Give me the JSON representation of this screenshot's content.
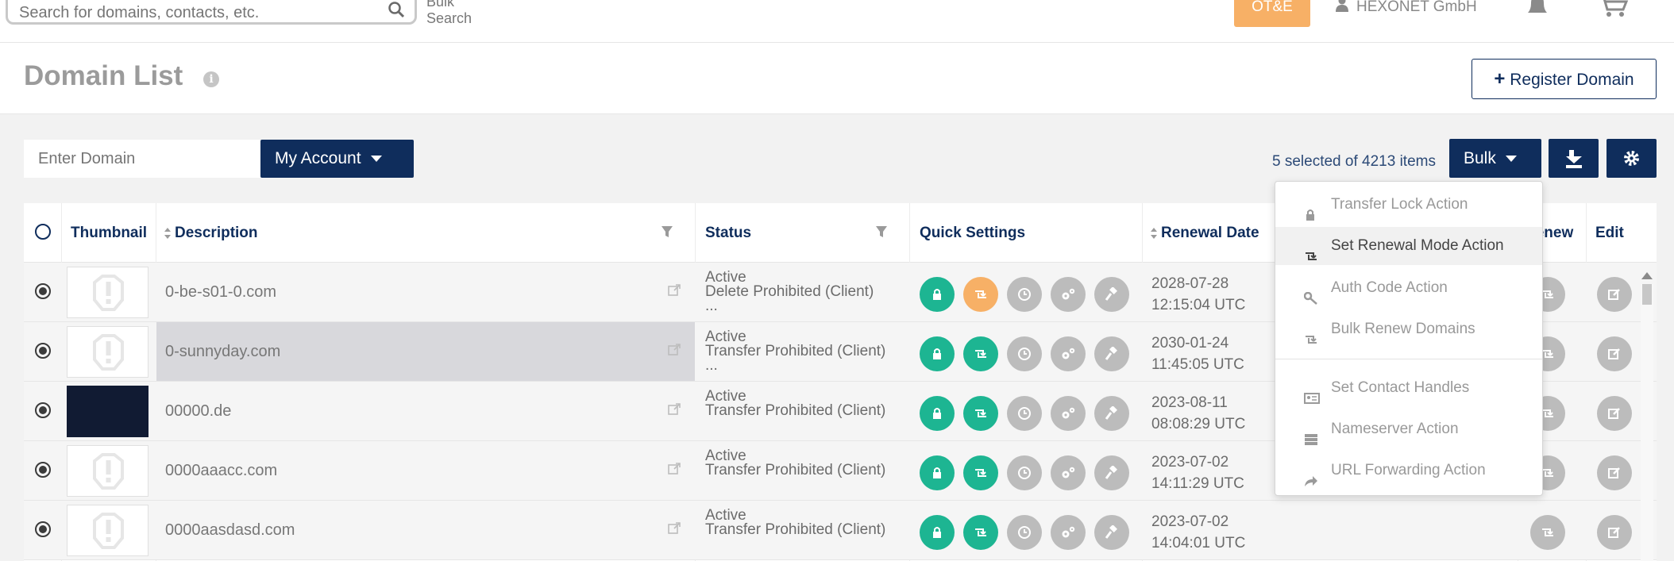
{
  "topbar": {
    "search_placeholder": "Search for domains, contacts, etc.",
    "bulk_search_line1": "Bulk",
    "bulk_search_line2": "Search",
    "env_badge": "OT&E",
    "account_name": "HEXONET GmbH"
  },
  "header": {
    "title": "Domain List",
    "register_label": "Register Domain"
  },
  "filters": {
    "domain_placeholder": "Enter Domain",
    "account_label": "My Account",
    "selection_text": "5 selected of 4213 items",
    "bulk_label": "Bulk"
  },
  "table": {
    "columns": {
      "thumbnail": "Thumbnail",
      "description": "Description",
      "status": "Status",
      "quick_settings": "Quick Settings",
      "renewal_date": "Renewal Date",
      "renew": "Renew",
      "edit": "Edit"
    },
    "rows": [
      {
        "domain": "0-be-s01-0.com",
        "status1": "Active",
        "status2": "Delete Prohibited (Client)",
        "status3": "...",
        "date": "2028-07-28",
        "time": "12:15:04 UTC"
      },
      {
        "domain": "0-sunnyday.com",
        "status1": "Active",
        "status2": "Transfer Prohibited (Client)",
        "status3": "...",
        "date": "2030-01-24",
        "time": "11:45:05 UTC"
      },
      {
        "domain": "00000.de",
        "status1": "Active",
        "status2": "Transfer Prohibited (Client)",
        "status3": "",
        "date": "2023-08-11",
        "time": "08:08:29 UTC"
      },
      {
        "domain": "0000aaacc.com",
        "status1": "Active",
        "status2": "Transfer Prohibited (Client)",
        "status3": "",
        "date": "2023-07-02",
        "time": "14:11:29 UTC"
      },
      {
        "domain": "0000aasdasd.com",
        "status1": "Active",
        "status2": "Transfer Prohibited (Client)",
        "status3": "",
        "date": "2023-07-02",
        "time": "14:04:01 UTC"
      }
    ]
  },
  "bulk_menu": {
    "items": [
      {
        "label": "Transfer Lock Action"
      },
      {
        "label": "Set Renewal Mode Action"
      },
      {
        "label": "Auth Code Action"
      },
      {
        "label": "Bulk Renew Domains"
      },
      {
        "label": "Set Contact Handles"
      },
      {
        "label": "Nameserver Action"
      },
      {
        "label": "URL Forwarding Action"
      }
    ]
  },
  "colors": {
    "navy": "#0f2d5c",
    "green": "#1db592",
    "orange": "#f7b066",
    "grey": "#bcbcbc"
  }
}
